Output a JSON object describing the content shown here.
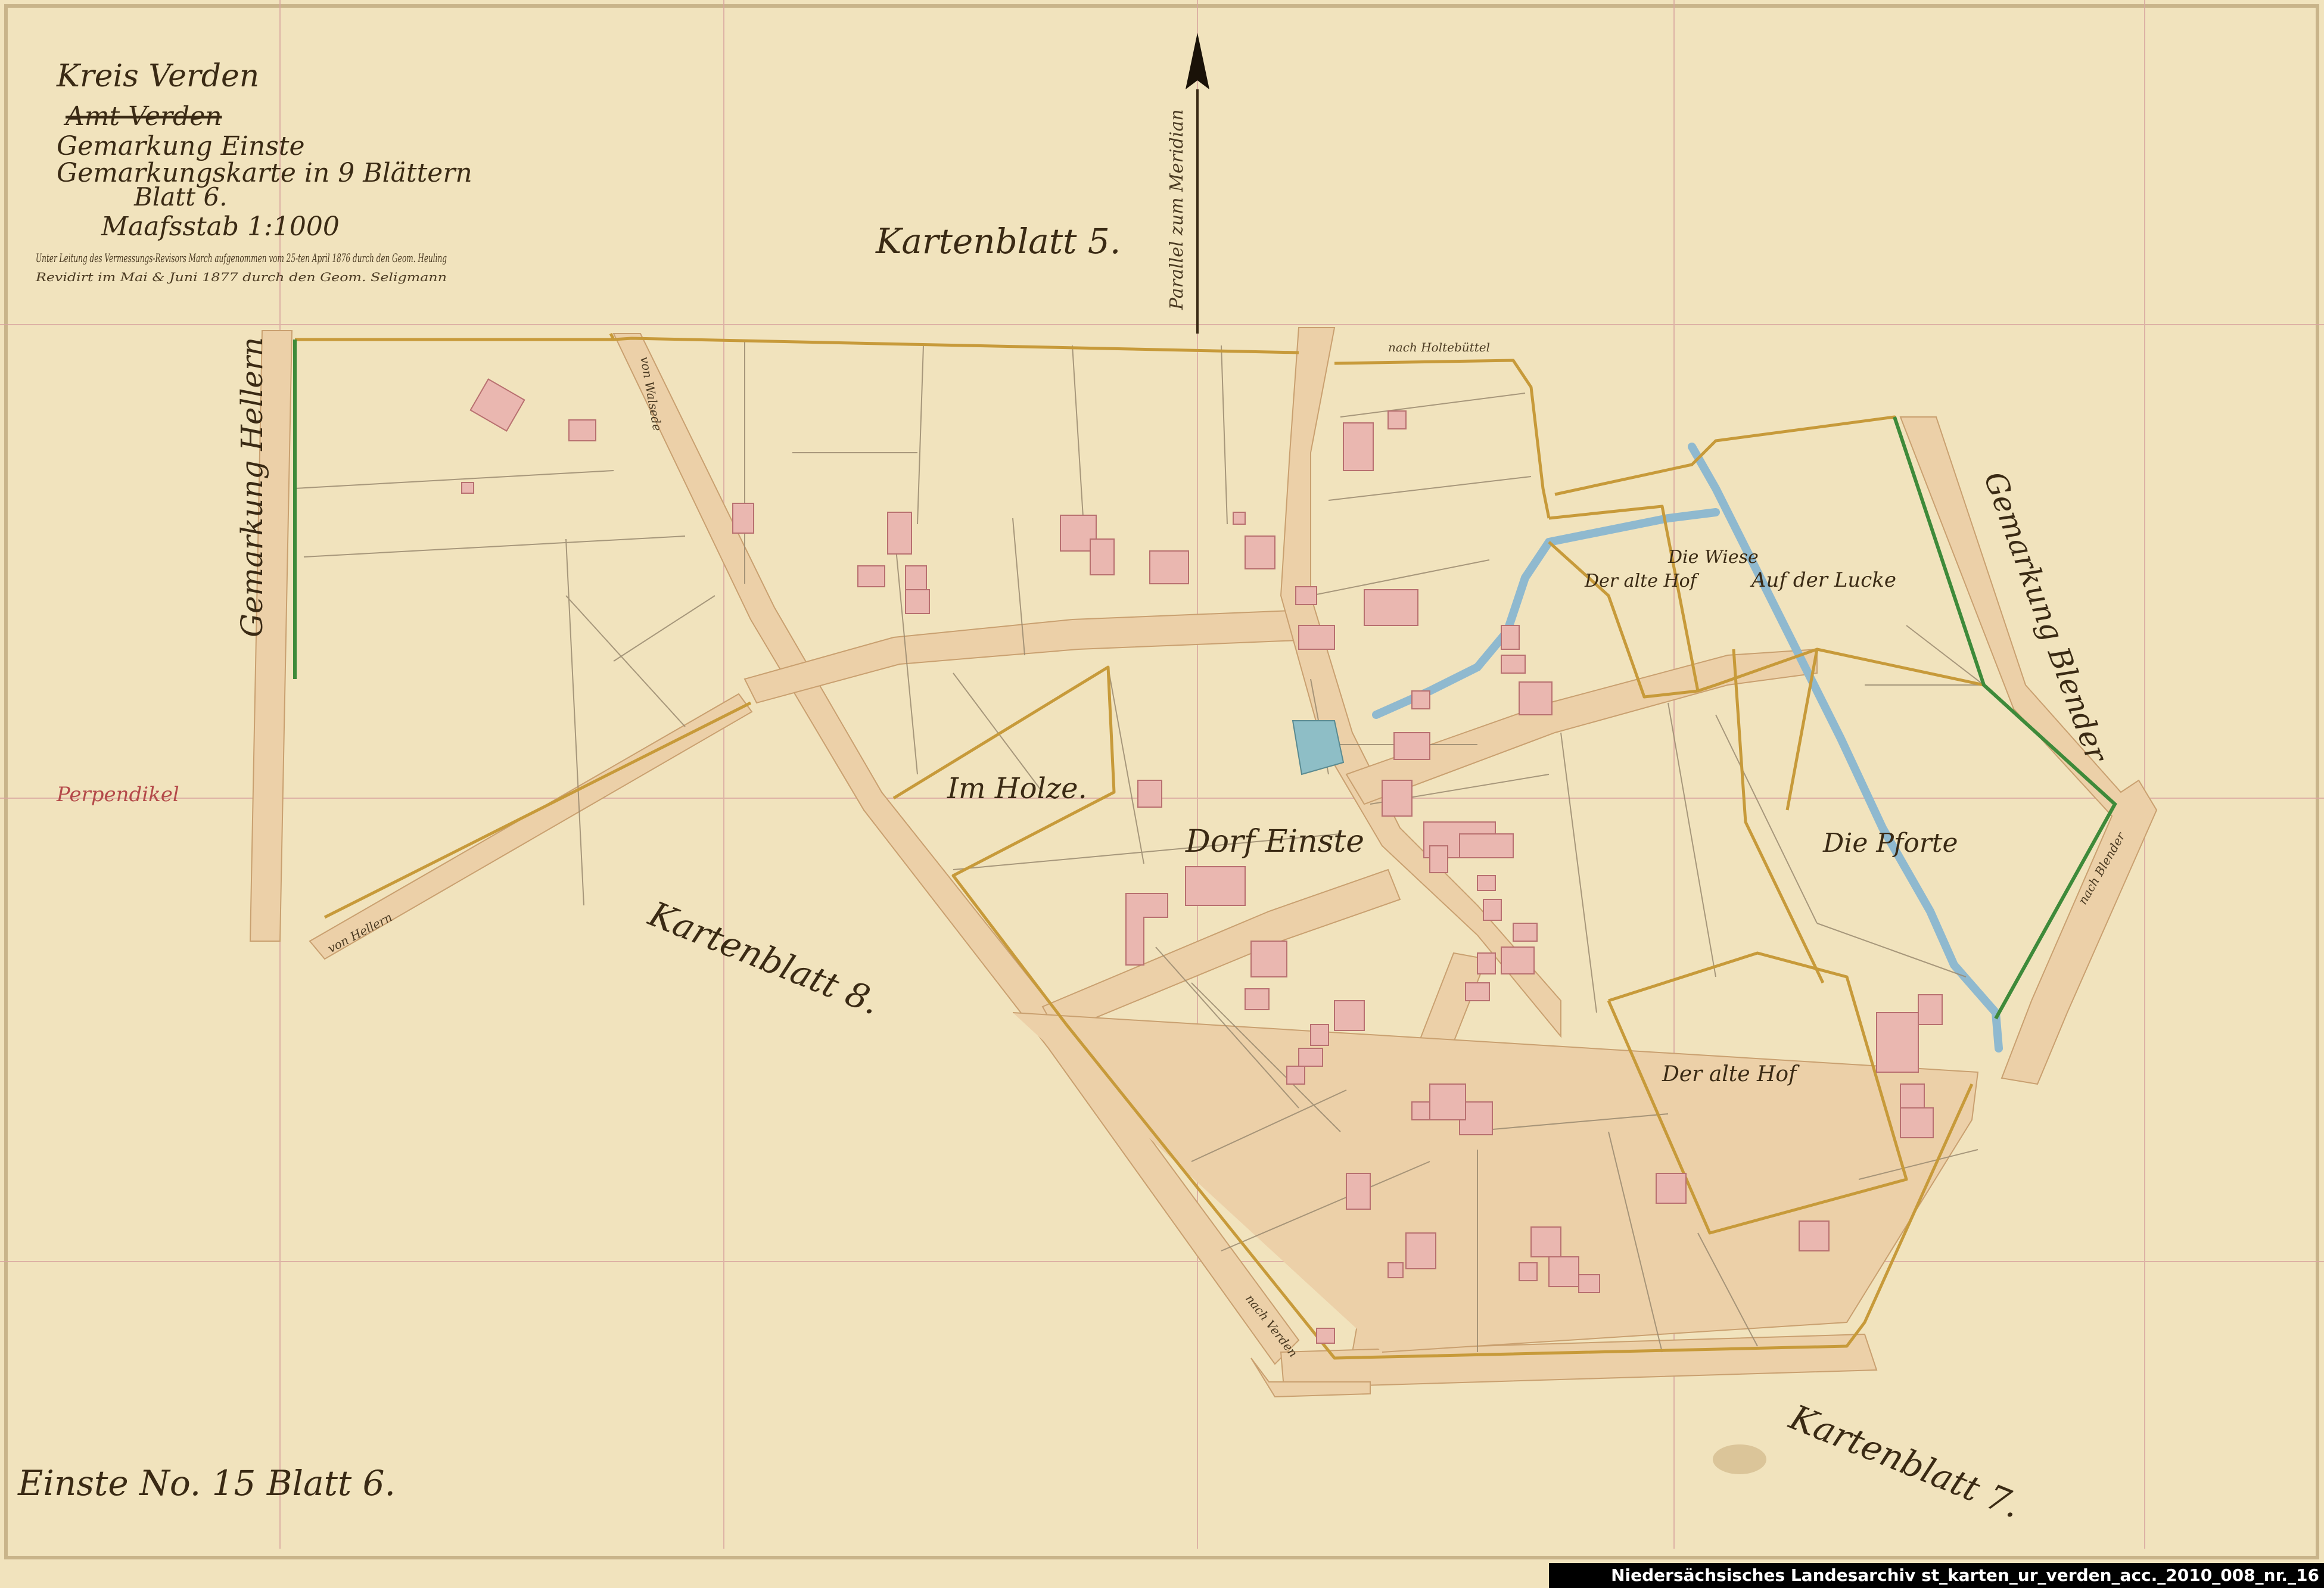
{
  "header": {
    "lines": [
      "Kreis Verden",
      "Amt Verden",
      "Gemarkung Einste",
      "Gemarkungskarte in 9 Blättern",
      "Blatt 6.",
      "Maafsstab 1:1000"
    ],
    "note": "Unter Leitung des Vermessungs-Revisors March aufgenommen vom 25-ten April 1876 durch den Geom. Heuling",
    "note2": "Revidirt im Mai & Juni 1877 durch den Geom. Seligmann"
  },
  "north_label": "Parallel zum Meridian",
  "labels": {
    "kartenblatt5": "Kartenblatt 5.",
    "kartenblatt7": "Kartenblatt 7.",
    "kartenblatt8": "Kartenblatt 8.",
    "gem_hellern": "Gemarkung Hellern",
    "gem_blender": "Gemarkung Blender",
    "perpendikel": "Perpendikel",
    "im_holze": "Im Holze.",
    "dorf_einste": "Dorf Einste",
    "alte_hof_1": "Der alte Hof",
    "alte_hof_2": "Der alte Hof",
    "die_wiese": "Die Wiese",
    "auf_der_lucke": "Auf der Lucke",
    "die_pforte": "Die Pforte",
    "nach_holtebuttel": "nach Holtebüttel",
    "nach_verden": "nach Verden",
    "nach_blender": "nach Blender",
    "von_hellern": "von Hellern",
    "von_walsrode": "von Walsede"
  },
  "sheet_title": "Einste No. 15 Blatt 6.",
  "footer_text": "Niedersächsisches Landesarchiv st_karten_ur_verden_acc._2010_008_nr._16",
  "colors": {
    "paper": "#f1e3bd",
    "road": "#ecd0a8",
    "building": "#eab7b0",
    "boundary": "#c79a3a",
    "water": "#8fb9cf",
    "green": "#3e8a3a"
  }
}
